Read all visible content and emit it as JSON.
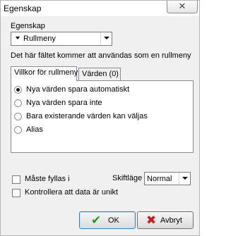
{
  "window": {
    "title": "Egenskap",
    "close_glyph": "✕"
  },
  "property": {
    "label": "Egenskap",
    "selected": "Rullmeny",
    "type_icon": "dropdown-marker-icon"
  },
  "info_text": "Det här fältet kommer att användas som en rullmeny",
  "tabs": [
    {
      "label": "Villkor för rullmeny",
      "active": true
    },
    {
      "label": "Värden (0)",
      "active": false
    }
  ],
  "options": [
    {
      "label": "Nya värden spara automatiskt",
      "selected": true
    },
    {
      "label": "Nya värden spara inte",
      "selected": false
    },
    {
      "label": "Bara existerande värden kan väljas",
      "selected": false
    },
    {
      "label": "Alias",
      "selected": false
    }
  ],
  "required": {
    "label": "Måste fyllas i",
    "checked": false
  },
  "unique": {
    "label": "Kontrollera att data är unikt",
    "checked": false
  },
  "case_mode": {
    "label": "Skiftläge",
    "selected": "Normal"
  },
  "buttons": {
    "ok": {
      "label": "OK",
      "icon": "checkmark-icon",
      "color": "#1e9b1e"
    },
    "cancel": {
      "label": "Avbryt",
      "icon": "cross-icon",
      "color": "#c41e1e"
    }
  }
}
